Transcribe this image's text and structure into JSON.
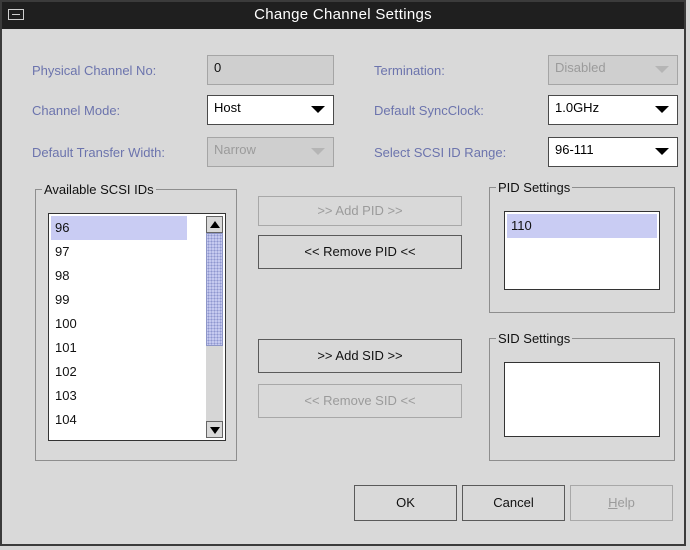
{
  "window": {
    "title": "Change Channel Settings"
  },
  "fields": {
    "physical_channel_label": "Physical Channel No:",
    "physical_channel_value": "0",
    "channel_mode_label": "Channel Mode:",
    "channel_mode_value": "Host",
    "transfer_width_label": "Default Transfer Width:",
    "transfer_width_value": "Narrow",
    "termination_label": "Termination:",
    "termination_value": "Disabled",
    "sync_clock_label": "Default SyncClock:",
    "sync_clock_value": "1.0GHz",
    "scsi_range_label": "Select SCSI ID Range:",
    "scsi_range_value": "96-111"
  },
  "available": {
    "label": "Available SCSI IDs",
    "items": [
      "96",
      "97",
      "98",
      "99",
      "100",
      "101",
      "102",
      "103",
      "104"
    ],
    "selected": "96"
  },
  "pid": {
    "label": "PID Settings",
    "items": [
      "110"
    ]
  },
  "sid": {
    "label": "SID Settings",
    "items": []
  },
  "buttons": {
    "add_pid": ">>  Add PID  >>",
    "remove_pid": "<< Remove PID <<",
    "add_sid": ">>  Add SID  >>",
    "remove_sid": "<< Remove SID <<",
    "ok": "OK",
    "cancel": "Cancel",
    "help_h": "H",
    "help_rest": "elp"
  }
}
